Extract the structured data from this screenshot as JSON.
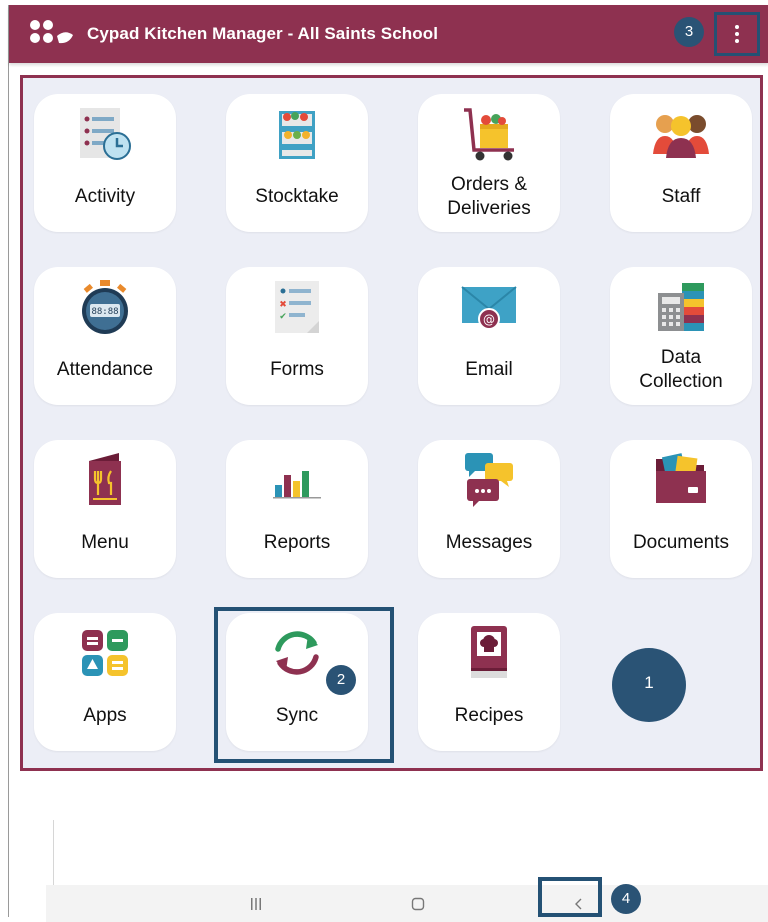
{
  "header": {
    "title": "Cypad Kitchen Manager - All Saints School",
    "logo_icon": "cypad-logo-icon",
    "menu_icon": "kebab-menu-icon",
    "background_color": "#8e3150"
  },
  "tiles": [
    {
      "label": "Activity",
      "icon": "activity-clock-icon"
    },
    {
      "label": "Stocktake",
      "icon": "stock-shelf-icon"
    },
    {
      "label": "Orders &\nDeliveries",
      "icon": "delivery-trolley-icon"
    },
    {
      "label": "Staff",
      "icon": "staff-group-icon"
    },
    {
      "label": "Attendance",
      "icon": "stopwatch-icon"
    },
    {
      "label": "Forms",
      "icon": "checklist-form-icon"
    },
    {
      "label": "Email",
      "icon": "email-envelope-icon"
    },
    {
      "label": "Data\nCollection",
      "icon": "data-calculator-icon"
    },
    {
      "label": "Menu",
      "icon": "menu-cutlery-icon"
    },
    {
      "label": "Reports",
      "icon": "bar-chart-icon"
    },
    {
      "label": "Messages",
      "icon": "chat-bubbles-icon"
    },
    {
      "label": "Documents",
      "icon": "folder-documents-icon"
    },
    {
      "label": "Apps",
      "icon": "apps-grid-icon"
    },
    {
      "label": "Sync",
      "icon": "sync-arrows-icon"
    },
    {
      "label": "Recipes",
      "icon": "recipe-book-icon"
    }
  ],
  "markers": {
    "one": "1",
    "two": "2",
    "three": "3",
    "four": "4"
  },
  "navigation": {
    "recents_icon": "recents-lines-icon",
    "home_icon": "home-square-icon",
    "back_icon": "back-chevron-icon"
  },
  "colors": {
    "brand": "#8e3150",
    "highlight_border": "#245174",
    "panel_background": "#eceef6",
    "green": "#2e9a5d",
    "yellow": "#f5c32c",
    "teal": "#2b93b6"
  }
}
